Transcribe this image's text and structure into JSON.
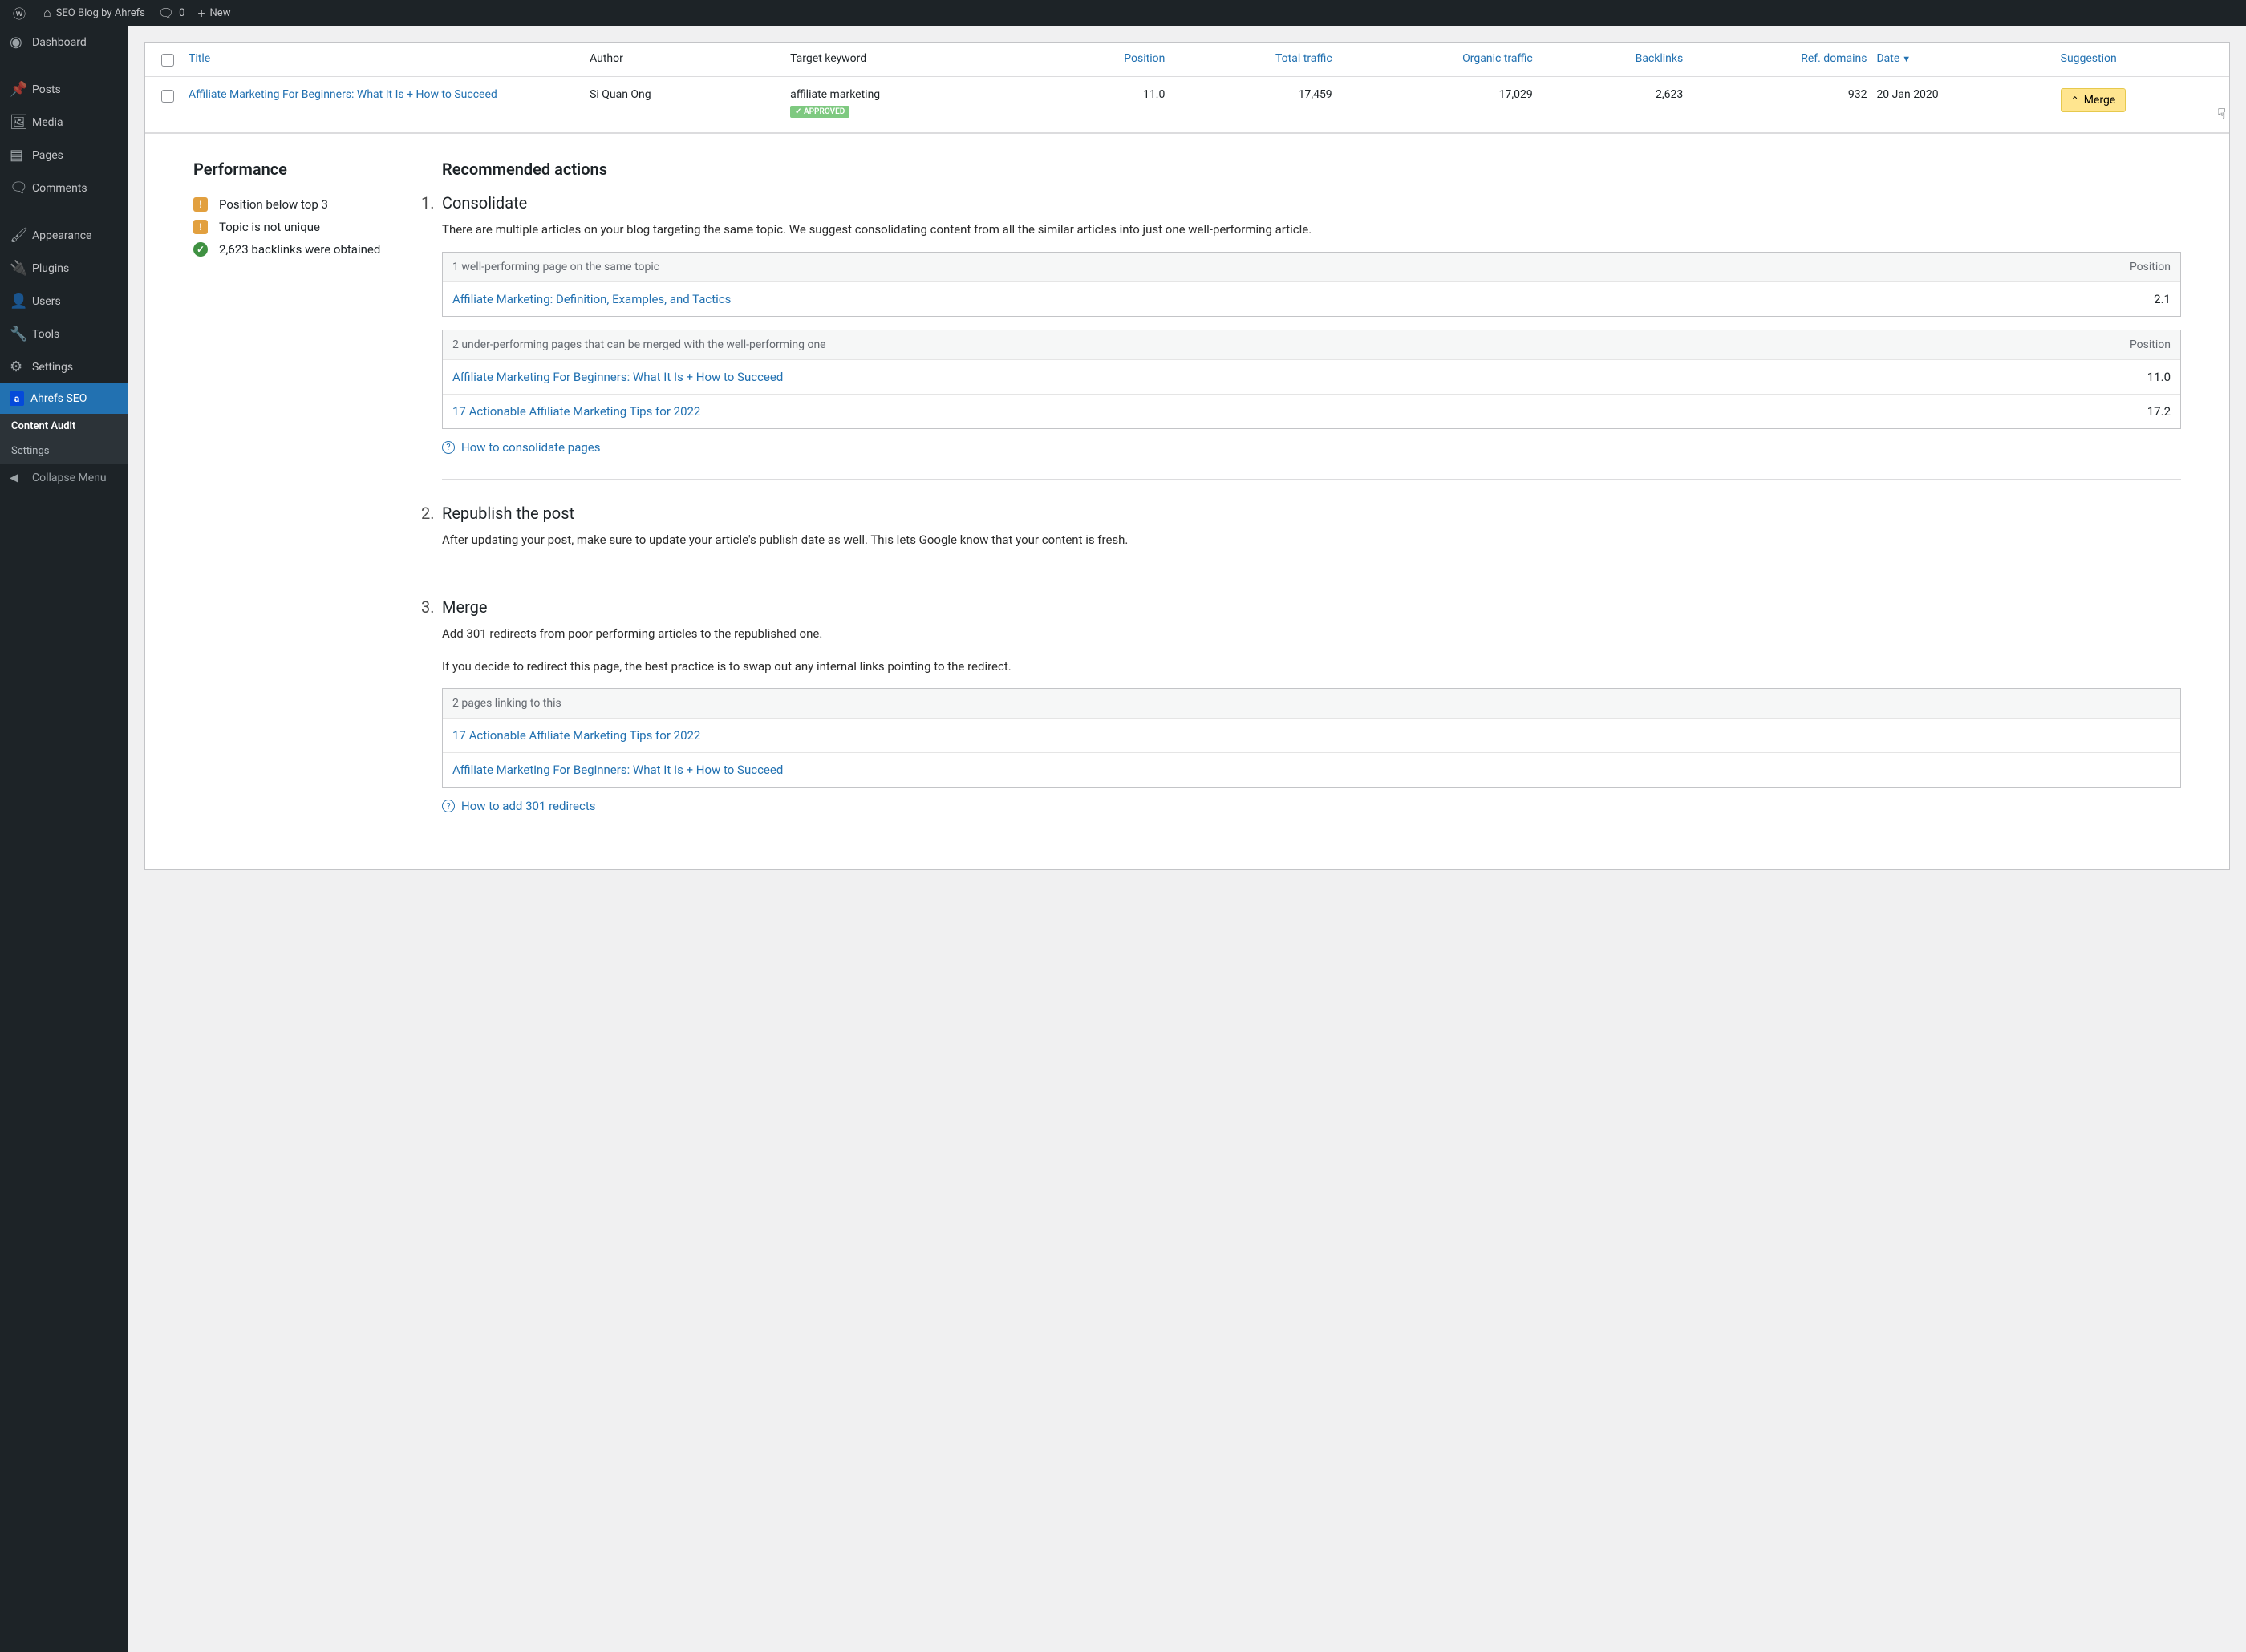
{
  "topbar": {
    "site_name": "SEO Blog by Ahrefs",
    "comments_count": "0",
    "new_label": "New"
  },
  "sidebar": {
    "items": [
      {
        "label": "Dashboard"
      },
      {
        "label": "Posts"
      },
      {
        "label": "Media"
      },
      {
        "label": "Pages"
      },
      {
        "label": "Comments"
      },
      {
        "label": "Appearance"
      },
      {
        "label": "Plugins"
      },
      {
        "label": "Users"
      },
      {
        "label": "Tools"
      },
      {
        "label": "Settings"
      },
      {
        "label": "Ahrefs SEO"
      }
    ],
    "sub": {
      "content_audit": "Content Audit",
      "settings": "Settings"
    },
    "collapse": "Collapse Menu"
  },
  "table": {
    "headers": {
      "title": "Title",
      "author": "Author",
      "target_keyword": "Target keyword",
      "position": "Position",
      "total_traffic": "Total traffic",
      "organic_traffic": "Organic traffic",
      "backlinks": "Backlinks",
      "ref_domains": "Ref. domains",
      "date": "Date",
      "suggestion": "Suggestion"
    },
    "row": {
      "title": "Affiliate Marketing For Beginners: What It Is + How to Succeed",
      "author": "Si Quan Ong",
      "keyword": "affiliate marketing",
      "approved": "✓ APPROVED",
      "position": "11.0",
      "total_traffic": "17,459",
      "organic_traffic": "17,029",
      "backlinks": "2,623",
      "ref_domains": "932",
      "date": "20 Jan 2020",
      "merge_btn": "Merge"
    }
  },
  "performance": {
    "heading": "Performance",
    "items": [
      {
        "type": "warn",
        "text": "Position below top 3"
      },
      {
        "type": "warn",
        "text": "Topic is not unique"
      },
      {
        "type": "ok",
        "text": "2,623 backlinks were obtained"
      }
    ]
  },
  "actions": {
    "heading": "Recommended actions",
    "consolidate": {
      "num": "1.",
      "title": "Consolidate",
      "desc": "There are multiple articles on your blog targeting the same topic. We suggest consolidating content from all the similar articles into just one well-performing article.",
      "box1_head": "1 well-performing page on the same topic",
      "box1_head_r": "Position",
      "box1_rows": [
        {
          "t": "Affiliate Marketing: Definition, Examples, and Tactics",
          "p": "2.1"
        }
      ],
      "box2_head": "2 under-performing pages that can be merged with the well-performing one",
      "box2_head_r": "Position",
      "box2_rows": [
        {
          "t": "Affiliate Marketing For Beginners: What It Is + How to Succeed",
          "p": "11.0"
        },
        {
          "t": "17 Actionable Affiliate Marketing Tips for 2022",
          "p": "17.2"
        }
      ],
      "help": "How to consolidate pages"
    },
    "republish": {
      "num": "2.",
      "title": "Republish the post",
      "desc": "After updating your post, make sure to update your article's publish date as well. This lets Google know that your content is fresh."
    },
    "merge": {
      "num": "3.",
      "title": "Merge",
      "desc1": "Add 301 redirects from poor performing articles to the republished one.",
      "desc2": "If you decide to redirect this page, the best practice is to swap out any internal links pointing to the redirect.",
      "box_head": "2 pages linking to this",
      "box_rows": [
        {
          "t": "17 Actionable Affiliate Marketing Tips for 2022"
        },
        {
          "t": "Affiliate Marketing For Beginners: What It Is + How to Succeed"
        }
      ],
      "help": "How to add 301 redirects"
    }
  }
}
